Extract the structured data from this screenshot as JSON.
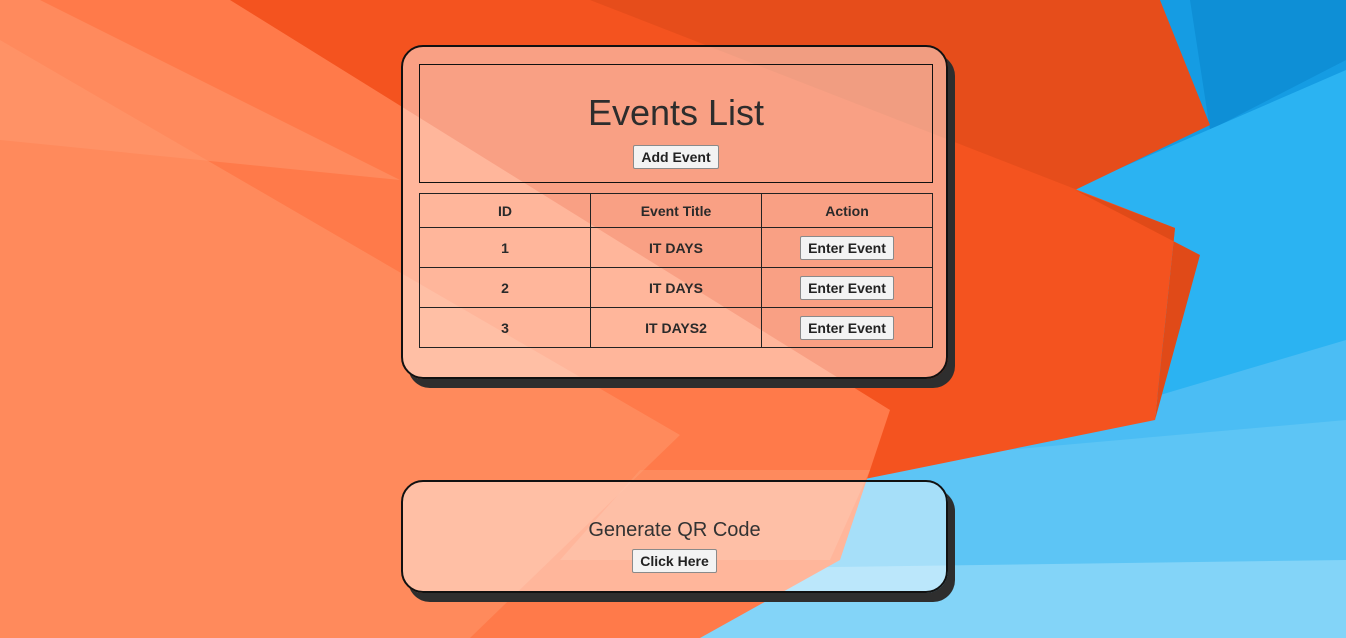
{
  "colors": {
    "orange_dark": "#f25022",
    "orange_light": "#fb8c64",
    "blue_dark": "#1ea3e6",
    "blue_light": "#7fd1f7"
  },
  "events_card": {
    "title": "Events List",
    "add_button_label": "Add Event",
    "columns": [
      "ID",
      "Event Title",
      "Action"
    ],
    "rows": [
      {
        "id": "1",
        "title": "IT DAYS",
        "action": "Enter Event"
      },
      {
        "id": "2",
        "title": "IT DAYS",
        "action": "Enter Event"
      },
      {
        "id": "3",
        "title": "IT DAYS2",
        "action": "Enter Event"
      }
    ]
  },
  "qr_card": {
    "title": "Generate QR Code",
    "button_label": "Click Here"
  }
}
